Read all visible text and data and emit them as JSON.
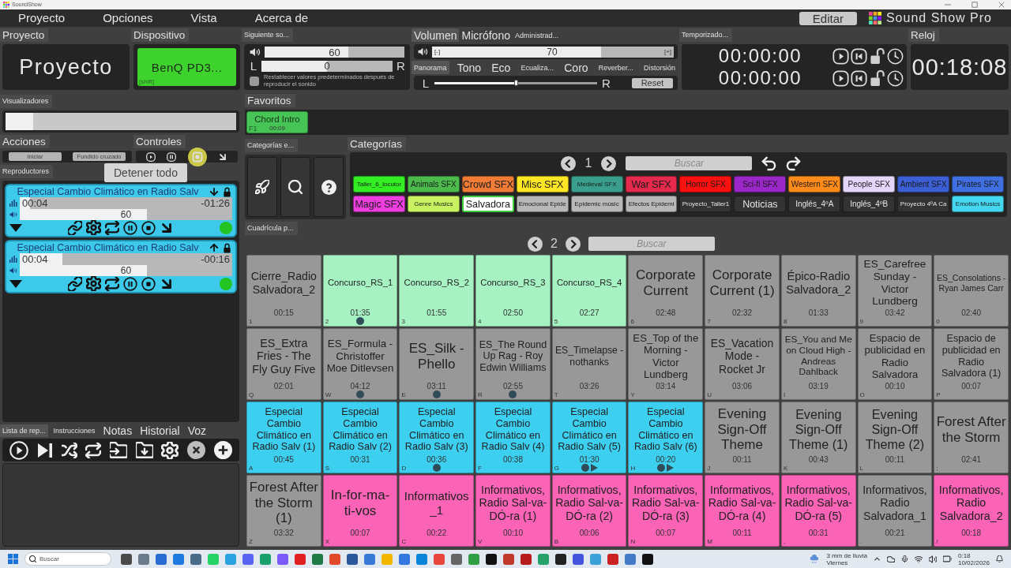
{
  "window": {
    "title": "SoundShow"
  },
  "menu": [
    "Proyecto",
    "Opciones",
    "Vista",
    "Acerca de"
  ],
  "header": {
    "edit_button": "Editar",
    "app_name": "Sound Show Pro"
  },
  "project": {
    "heading": "Proyecto",
    "name": "Proyecto"
  },
  "device": {
    "heading": "Dispositivo",
    "name": "BenQ PD3...",
    "shortcut": "[shift]"
  },
  "next_sound": {
    "heading": "Siguiente so...",
    "volume": {
      "reading": "60",
      "level": 0.6
    },
    "balance": {
      "left": "L",
      "reading": "0",
      "right": "R",
      "level": 0.5
    },
    "reset_option": {
      "label": "Restablecer valores predeterminados después de reproducir el sonido",
      "checked": false
    }
  },
  "audio": {
    "tabs": [
      {
        "label": "Volumen",
        "selected": true
      },
      {
        "label": "Micrófono",
        "selected": false
      },
      {
        "label": "Administrad...",
        "selected": false
      }
    ],
    "volume": {
      "minus": "[-]",
      "reading": "70",
      "plus": "[+]",
      "level": 0.7
    },
    "effects": [
      {
        "label": "Panorama",
        "selected": true
      },
      {
        "label": "Tono",
        "selected": false
      },
      {
        "label": "Eco",
        "selected": false
      },
      {
        "label": "Ecualiza...",
        "selected": false
      },
      {
        "label": "Coro",
        "selected": false
      },
      {
        "label": "Reverber...",
        "selected": false
      },
      {
        "label": "Distorsión",
        "selected": false
      }
    ],
    "pan": {
      "left": "L",
      "right": "R",
      "level": 0.5
    },
    "reset_button": "Reset"
  },
  "timers": {
    "heading": "Temporizado...",
    "items": [
      {
        "time": "00:00:00",
        "locked": false
      },
      {
        "time": "00:00:00",
        "locked": false
      }
    ]
  },
  "clock": {
    "heading": "Reloj",
    "time": "00:18:08"
  },
  "visualizers": {
    "heading": "Visualizadores",
    "level": 0.12
  },
  "actions": {
    "heading": "Acciones",
    "buttons": [
      "Iniciar",
      "Fundido cruzado"
    ]
  },
  "controls": {
    "heading": "Controles",
    "tooltip": "Detener todo"
  },
  "players": {
    "heading": "Reproductores",
    "items": [
      {
        "title": "Especial Cambio Climático en Radio Salv",
        "arrow_up": false,
        "locked": true,
        "progress": {
          "elapsed": "00:04",
          "remaining": "-01:26",
          "level": 0.05
        },
        "volume": {
          "reading": "60",
          "level": 0.6
        }
      },
      {
        "title": "Especial Cambio Climático en Radio Salv",
        "arrow_up": true,
        "locked": true,
        "progress": {
          "elapsed": "00:04",
          "remaining": "-00:16",
          "level": 0.2
        },
        "volume": {
          "reading": "60",
          "level": 0.6
        }
      }
    ]
  },
  "playlist": {
    "tabs": [
      {
        "label": "Lista de rep...",
        "selected": true
      },
      {
        "label": "Instrucciones",
        "selected": false
      },
      {
        "label": "Notas",
        "selected": false
      },
      {
        "label": "Historial",
        "selected": false
      },
      {
        "label": "Voz",
        "selected": false
      }
    ]
  },
  "favorites": {
    "heading": "Favoritos",
    "items": [
      {
        "title": "Chord Intro",
        "time": "00:09",
        "key": "F1"
      }
    ]
  },
  "category_tools": {
    "heading": "Categorías e..."
  },
  "categories": {
    "heading": "Categorías",
    "page": "1",
    "search_placeholder": "Buscar",
    "items": [
      {
        "label": "Taller_6_locutor",
        "color": "#33ee22",
        "selected": false
      },
      {
        "label": "Animals SFX",
        "color": "#4cbb4c",
        "selected": false
      },
      {
        "label": "Crowd SFX",
        "color": "#f27c36",
        "selected": false
      },
      {
        "label": "Misc SFX",
        "color": "#fde725",
        "selected": false
      },
      {
        "label": "Medieval SFX",
        "color": "#3a9e8c",
        "selected": false
      },
      {
        "label": "War SFX",
        "color": "#e52a4e",
        "selected": false
      },
      {
        "label": "Horror SFX",
        "color": "#ff1010",
        "selected": false
      },
      {
        "label": "Sci-fi SFX",
        "color": "#9b27c9",
        "selected": false
      },
      {
        "label": "Western SFX",
        "color": "#ff8c1a",
        "selected": false
      },
      {
        "label": "People SFX",
        "color": "#e4d6fb",
        "selected": false
      },
      {
        "label": "Ambient SFX",
        "color": "#3c5fd6",
        "selected": false
      },
      {
        "label": "Pirates SFX",
        "color": "#3f6fe0",
        "selected": false
      },
      {
        "label": "Magic SFX",
        "color": "#ee3ee0",
        "selected": false
      },
      {
        "label": "Genre Musics",
        "color": "#c9f261",
        "selected": false
      },
      {
        "label": "Salvadora",
        "color": "#ffffff",
        "selected": true
      },
      {
        "label": "Emocional Epide",
        "color": "#b8b8b8",
        "selected": false
      },
      {
        "label": "Epidemic músic",
        "color": "#b8b8b8",
        "selected": false
      },
      {
        "label": "Efectos Epidemi",
        "color": "#b8b8b8",
        "selected": false
      },
      {
        "label": "Proyecto_Taller1",
        "color": "#333333",
        "selected": false
      },
      {
        "label": "Noticias",
        "color": "#333333",
        "selected": false
      },
      {
        "label": "Inglés_4ºA",
        "color": "#333333",
        "selected": false
      },
      {
        "label": "Inglés_4ºB",
        "color": "#333333",
        "selected": false
      },
      {
        "label": "Proyecto 4ºA Ca",
        "color": "#333333",
        "selected": false
      },
      {
        "label": "Emotion Musics",
        "color": "#45d6f0",
        "selected": false
      }
    ]
  },
  "grid": {
    "heading": "Cuadrícula p...",
    "page": "2",
    "search_placeholder": "Buscar",
    "cells": [
      {
        "title": "Cierre_Radio Salvadora_2",
        "time": "00:15",
        "key": "1",
        "color": "#989898",
        "played": false,
        "playing": false
      },
      {
        "title": "Concurso_RS_1",
        "time": "01:35",
        "key": "2",
        "color": "#a6f2c3",
        "played": true,
        "playing": false
      },
      {
        "title": "Concurso_RS_2",
        "time": "01:55",
        "key": "3",
        "color": "#a6f2c3",
        "played": false,
        "playing": false
      },
      {
        "title": "Concurso_RS_3",
        "time": "02:50",
        "key": "4",
        "color": "#a6f2c3",
        "played": false,
        "playing": false
      },
      {
        "title": "Concurso_RS_4",
        "time": "02:27",
        "key": "5",
        "color": "#a6f2c3",
        "played": false,
        "playing": false
      },
      {
        "title": "Corporate Current",
        "time": "02:48",
        "key": "6",
        "color": "#989898",
        "played": false,
        "playing": false
      },
      {
        "title": "Corporate Current (1)",
        "time": "02:32",
        "key": "7",
        "color": "#989898",
        "played": false,
        "playing": false
      },
      {
        "title": "Épico-Radio Salvadora_2",
        "time": "01:33",
        "key": "8",
        "color": "#989898",
        "played": false,
        "playing": false
      },
      {
        "title": "ES_Carefree Sunday - Victor Lundberg",
        "time": "03:42",
        "key": "9",
        "color": "#989898",
        "played": false,
        "playing": false
      },
      {
        "title": "ES_Consolations - Ryan James Carr",
        "time": "02:40",
        "key": "0",
        "color": "#989898",
        "played": false,
        "playing": false
      },
      {
        "title": "ES_Extra Fries - The Fly Guy Five",
        "time": "02:01",
        "key": "Q",
        "color": "#989898",
        "played": false,
        "playing": false
      },
      {
        "title": "ES_Formula - Christoffer Moe Ditlevsen",
        "time": "04:12",
        "key": "W",
        "color": "#989898",
        "played": true,
        "playing": false
      },
      {
        "title": "ES_Silk - Phello",
        "time": "03:11",
        "key": "E",
        "color": "#989898",
        "played": true,
        "playing": false
      },
      {
        "title": "ES_The Round Up Rag - Roy Edwin Williams",
        "time": "02:55",
        "key": "R",
        "color": "#989898",
        "played": true,
        "playing": false
      },
      {
        "title": "ES_Timelapse - nothanks",
        "time": "03:26",
        "key": "T",
        "color": "#989898",
        "played": false,
        "playing": false
      },
      {
        "title": "ES_Top of the Morning - Victor Lundberg",
        "time": "03:14",
        "key": "Y",
        "color": "#989898",
        "played": false,
        "playing": false
      },
      {
        "title": "ES_Vacation Mode - Rocket Jr",
        "time": "03:06",
        "key": "U",
        "color": "#989898",
        "played": false,
        "playing": false
      },
      {
        "title": "ES_You and Me on Cloud High - Andreas Dahlback",
        "time": "03:19",
        "key": "I",
        "color": "#989898",
        "played": false,
        "playing": false
      },
      {
        "title": "Espacio de publicidad en Radio Salvadora",
        "time": "00:10",
        "key": "O",
        "color": "#989898",
        "played": false,
        "playing": false
      },
      {
        "title": "Espacio de publicidad en Radio Salvadora (1)",
        "time": "00:07",
        "key": "P",
        "color": "#989898",
        "played": false,
        "playing": false
      },
      {
        "title": "Especial Cambio Climático en Radio Salv (1)",
        "time": "00:45",
        "key": "A",
        "color": "#3ccff0",
        "played": false,
        "playing": false
      },
      {
        "title": "Especial Cambio Climático en Radio Salv (2)",
        "time": "00:31",
        "key": "S",
        "color": "#3ccff0",
        "played": false,
        "playing": false
      },
      {
        "title": "Especial Cambio Climático en Radio Salv (3)",
        "time": "00:36",
        "key": "D",
        "color": "#3ccff0",
        "played": true,
        "playing": false
      },
      {
        "title": "Especial Cambio Climático en Radio Salv (4)",
        "time": "00:38",
        "key": "F",
        "color": "#3ccff0",
        "played": false,
        "playing": false
      },
      {
        "title": "Especial Cambio Climático en Radio Salv (5)",
        "time": "01:30",
        "key": "G",
        "color": "#3ccff0",
        "played": true,
        "playing": true
      },
      {
        "title": "Especial Cambio Climático en Radio Salv (6)",
        "time": "00:20",
        "key": "H",
        "color": "#3ccff0",
        "played": true,
        "playing": true
      },
      {
        "title": "Evening Sign-Off Theme",
        "time": "00:11",
        "key": "J",
        "color": "#989898",
        "played": false,
        "playing": false
      },
      {
        "title": "Evening Sign-Off Theme (1)",
        "time": "00:43",
        "key": "K",
        "color": "#989898",
        "played": false,
        "playing": false
      },
      {
        "title": "Evening Sign-Off Theme (2)",
        "time": "00:11",
        "key": "L",
        "color": "#989898",
        "played": false,
        "playing": false
      },
      {
        "title": "Forest After the Storm",
        "time": "02:41",
        "key": ";",
        "color": "#989898",
        "played": false,
        "playing": false
      },
      {
        "title": "Forest After the Storm (1)",
        "time": "03:32",
        "key": "Z",
        "color": "#989898",
        "played": false,
        "playing": false
      },
      {
        "title": "In-for-ma-ti-vos",
        "time": "00:07",
        "key": "X",
        "color": "#fb63b6",
        "played": false,
        "playing": false
      },
      {
        "title": "Informativos _1",
        "time": "00:22",
        "key": "C",
        "color": "#fb63b6",
        "played": false,
        "playing": false
      },
      {
        "title": "Informativos, Radio Sal-va-DÓ-ra (1)",
        "time": "00:10",
        "key": "V",
        "color": "#fb63b6",
        "played": false,
        "playing": false
      },
      {
        "title": "Informativos, Radio Sal-va-DÓ-ra (2)",
        "time": "00:06",
        "key": "B",
        "color": "#fb63b6",
        "played": false,
        "playing": false
      },
      {
        "title": "Informativos, Radio Sal-va-DÓ-ra (3)",
        "time": "00:07",
        "key": "N",
        "color": "#fb63b6",
        "played": false,
        "playing": false
      },
      {
        "title": "Informativos, Radio Sal-va-DÓ-ra (4)",
        "time": "00:11",
        "key": "M",
        "color": "#fb63b6",
        "played": false,
        "playing": false
      },
      {
        "title": "Informativos, Radio Sal-va-DÓ-ra (5)",
        "time": "00:31",
        "key": ",",
        "color": "#fb63b6",
        "played": false,
        "playing": false
      },
      {
        "title": "Informativos, Radio Salvadora_1",
        "time": "00:21",
        "key": ".",
        "color": "#989898",
        "played": false,
        "playing": false
      },
      {
        "title": "Informativos, Radio Salvadora_2",
        "time": "00:18",
        "key": "/",
        "color": "#fb63b6",
        "played": false,
        "playing": false
      }
    ]
  },
  "taskbar": {
    "search_placeholder": "Buscar",
    "weather": "3 mm de lluvia",
    "weather_detail": "Viernes",
    "time": "0:18",
    "date": "10/02/2026"
  }
}
